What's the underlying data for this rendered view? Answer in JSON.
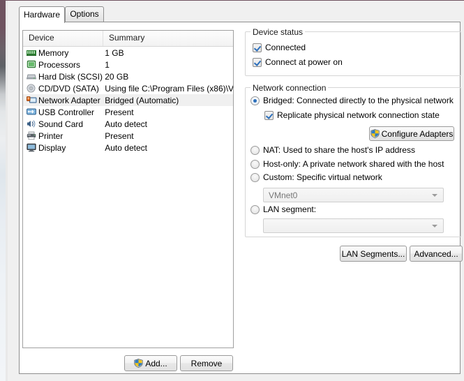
{
  "window": {
    "accent_frame": "#6f5360",
    "dialog_bg": "#f0f0f0"
  },
  "tabs": [
    {
      "label": "Hardware",
      "active": true
    },
    {
      "label": "Options",
      "active": false
    }
  ],
  "device_list": {
    "columns": [
      "Device",
      "Summary"
    ],
    "rows": [
      {
        "icon": "memory-icon",
        "device": "Memory",
        "summary": "1 GB",
        "selected": false
      },
      {
        "icon": "processor-icon",
        "device": "Processors",
        "summary": "1",
        "selected": false
      },
      {
        "icon": "hard-disk-icon",
        "device": "Hard Disk (SCSI)",
        "summary": "20 GB",
        "selected": false
      },
      {
        "icon": "cd-dvd-icon",
        "device": "CD/DVD (SATA)",
        "summary": "Using file C:\\Program Files (x86)\\V…",
        "selected": false
      },
      {
        "icon": "network-adapter-icon",
        "device": "Network Adapter",
        "summary": "Bridged (Automatic)",
        "selected": true
      },
      {
        "icon": "usb-controller-icon",
        "device": "USB Controller",
        "summary": "Present",
        "selected": false
      },
      {
        "icon": "sound-card-icon",
        "device": "Sound Card",
        "summary": "Auto detect",
        "selected": false
      },
      {
        "icon": "printer-icon",
        "device": "Printer",
        "summary": "Present",
        "selected": false
      },
      {
        "icon": "display-icon",
        "device": "Display",
        "summary": "Auto detect",
        "selected": false
      }
    ]
  },
  "left_buttons": {
    "add": "Add...",
    "remove": "Remove"
  },
  "device_status": {
    "title": "Device status",
    "connected": {
      "label": "Connected",
      "checked": true
    },
    "connect_at_power_on": {
      "label": "Connect at power on",
      "checked": true
    }
  },
  "network_connection": {
    "title": "Network connection",
    "selected": "bridged",
    "bridged": {
      "label": "Bridged: Connected directly to the physical network",
      "checked": true,
      "replicate": {
        "label": "Replicate physical network connection state",
        "checked": true
      },
      "configure_button": "Configure Adapters"
    },
    "nat": {
      "label": "NAT: Used to share the host's IP address",
      "checked": false
    },
    "host_only": {
      "label": "Host-only: A private network shared with the host",
      "checked": false
    },
    "custom": {
      "label": "Custom: Specific virtual network",
      "checked": false,
      "value": "VMnet0",
      "options": [
        "VMnet0"
      ]
    },
    "lan_segment": {
      "label": "LAN segment:",
      "checked": false,
      "value": "",
      "options": []
    }
  },
  "right_buttons": {
    "lan_segments": "LAN Segments...",
    "advanced": "Advanced..."
  }
}
